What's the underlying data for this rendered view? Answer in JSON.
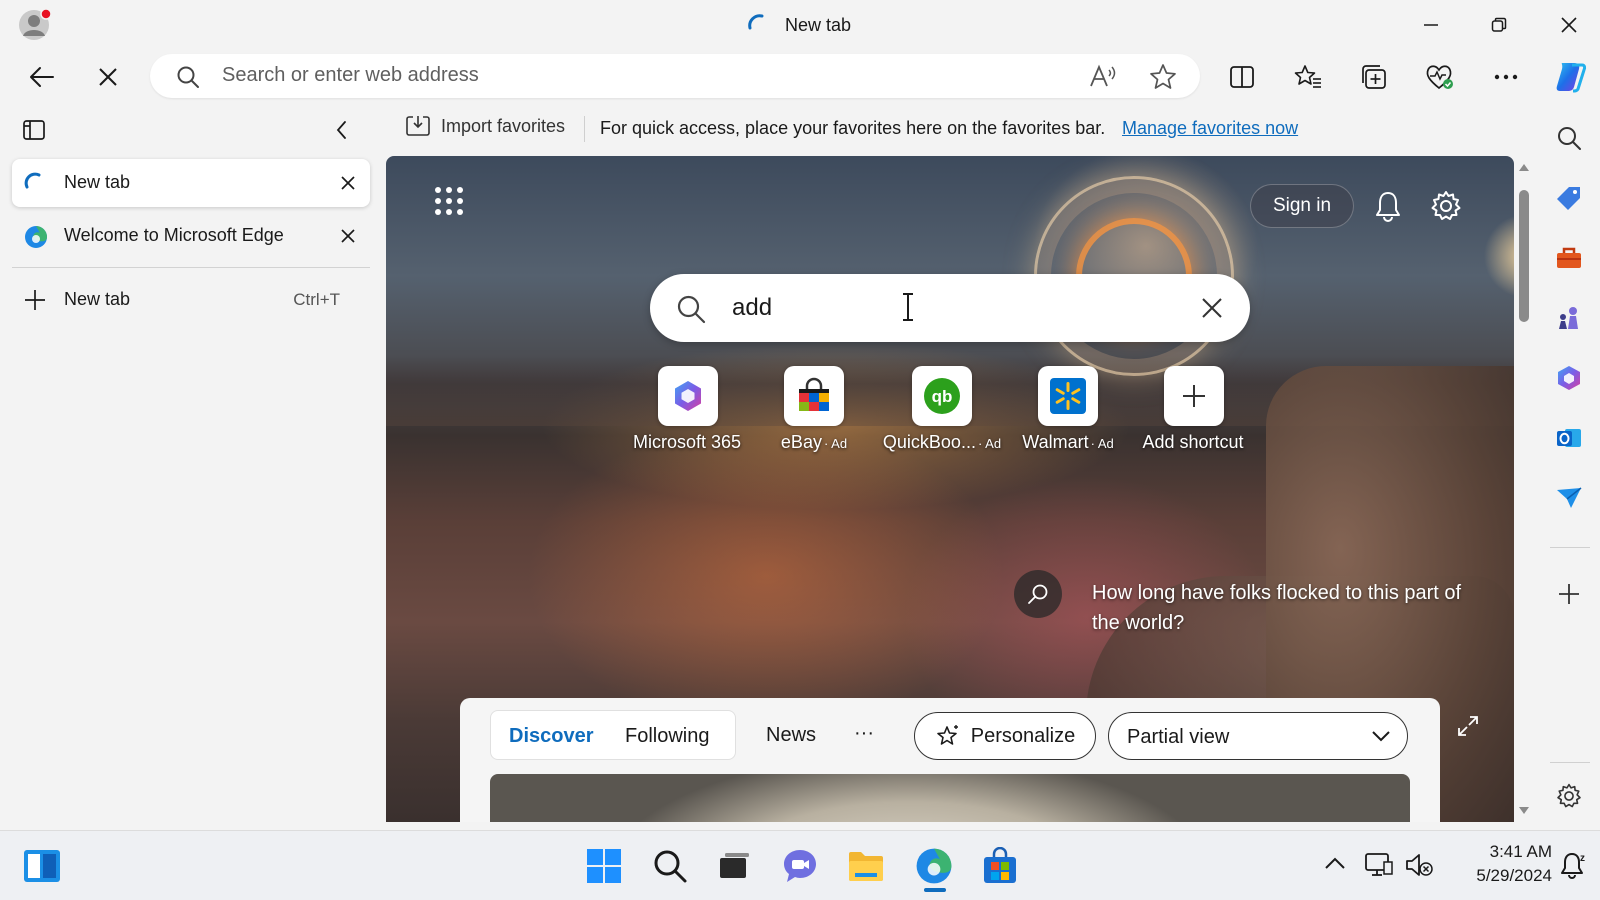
{
  "window": {
    "title": "New tab"
  },
  "nav": {
    "address_placeholder": "Search or enter web address"
  },
  "favorites_bar": {
    "import_label": "Import favorites",
    "message": "For quick access, place your favorites here on the favorites bar.",
    "link": "Manage favorites now"
  },
  "tabs": {
    "items": [
      {
        "label": "New tab",
        "active": true
      },
      {
        "label": "Welcome to Microsoft Edge",
        "active": false
      }
    ],
    "new_tab_label": "New tab",
    "new_tab_shortcut": "Ctrl+T"
  },
  "newtab_page": {
    "sign_in": "Sign in",
    "search_value": "add",
    "shortcuts": [
      {
        "label": "Microsoft 365",
        "ad": ""
      },
      {
        "label": "eBay",
        "ad": "· Ad"
      },
      {
        "label": "QuickBoo...",
        "ad": "· Ad"
      },
      {
        "label": "Walmart",
        "ad": "· Ad"
      },
      {
        "label": "Add shortcut",
        "ad": ""
      }
    ],
    "fact_text": "How long have folks flocked to this part of the world?",
    "feed": {
      "tab_discover": "Discover",
      "tab_following": "Following",
      "tab_news": "News",
      "more": "···",
      "personalize": "Personalize",
      "view_select": "Partial view"
    }
  },
  "taskbar": {
    "time": "3:41 AM",
    "date": "5/29/2024"
  },
  "colors": {
    "accent": "#0f6cbd",
    "edge_blue": "#1e88e5",
    "edge_green": "#3cb371"
  }
}
